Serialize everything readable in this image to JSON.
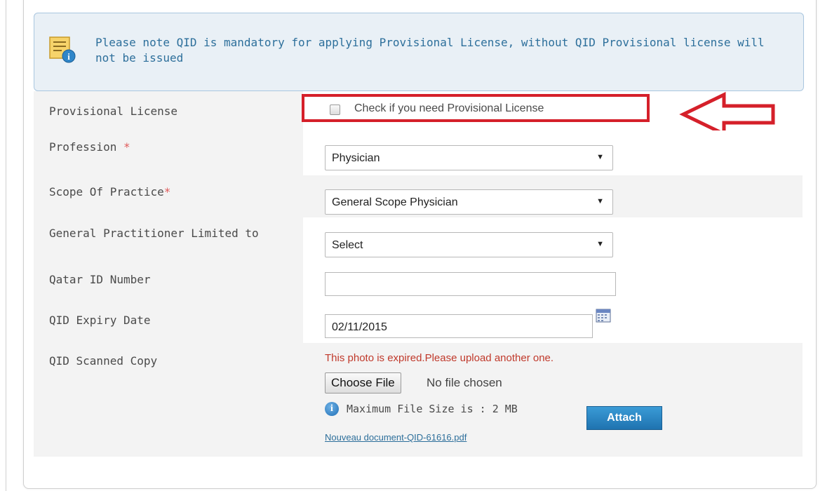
{
  "notice": {
    "text": "Please note QID is mandatory for applying Provisional License, without QID Provisional license will not be issued",
    "icon": "info-document-icon"
  },
  "form": {
    "provisional": {
      "label": "Provisional License",
      "checkbox_label": "Check if you need Provisional License",
      "checked": false
    },
    "profession": {
      "label": "Profession",
      "required_mark": "*",
      "selected": "Physician"
    },
    "scope": {
      "label": "Scope Of Practice",
      "required_mark": "*",
      "selected": "General Scope Physician"
    },
    "gp_limited": {
      "label": "General Practitioner Limited to",
      "selected": "Select"
    },
    "qid_number": {
      "label": "Qatar ID Number",
      "value": ""
    },
    "qid_expiry": {
      "label": "QID Expiry Date",
      "value": "02/11/2015",
      "icon": "calendar-icon"
    },
    "qid_scan": {
      "label": "QID Scanned Copy",
      "error": "This photo is expired.Please upload another one.",
      "choose_label": "Choose File",
      "no_file_text": "No file chosen",
      "max_size": "Maximum File Size is : 2 MB",
      "attach_label": "Attach",
      "file_link": "Nouveau document-QID-61616.pdf"
    }
  },
  "colors": {
    "highlight": "#d5202a",
    "notice_bg": "#e9f0f6",
    "notice_text": "#2d6f9b",
    "attach_bg": "#1f73b0"
  }
}
